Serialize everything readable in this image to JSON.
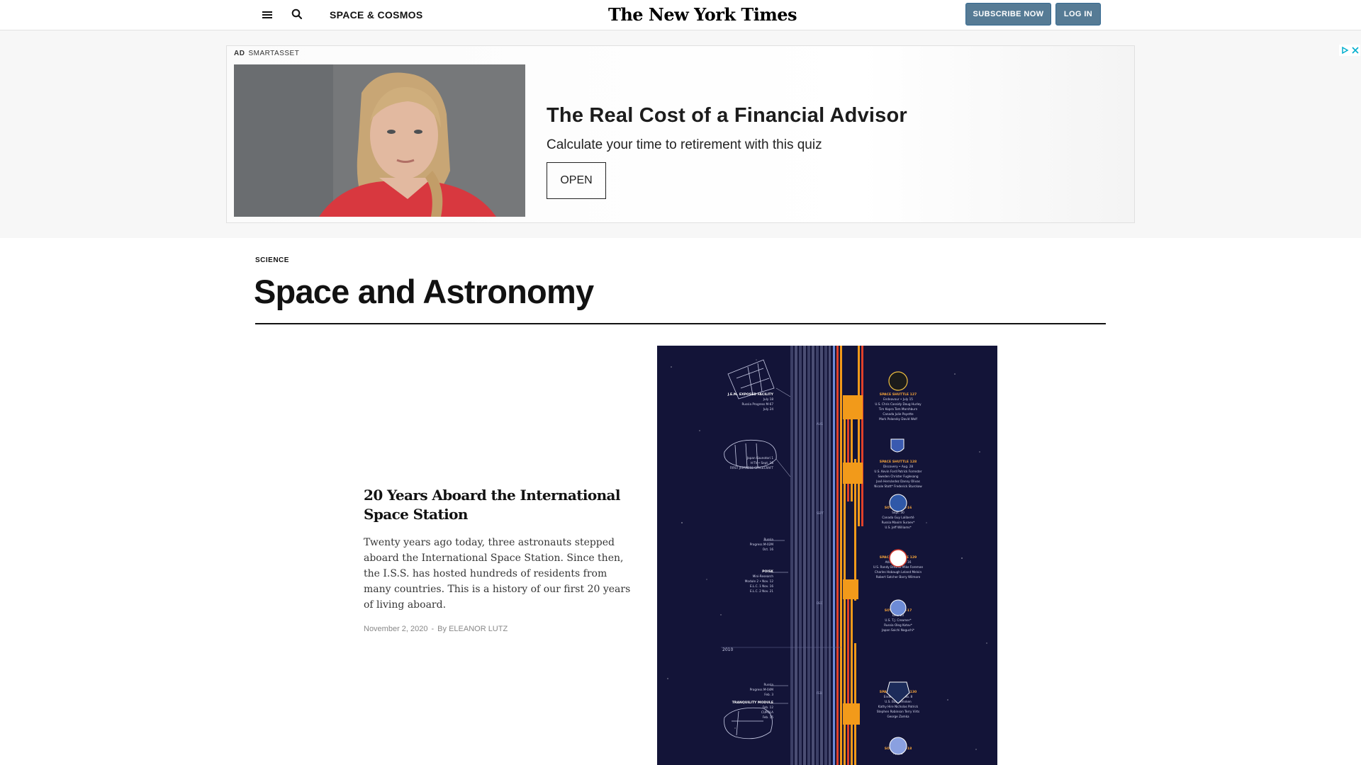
{
  "header": {
    "section_link": "SPACE & COSMOS",
    "logo": "The New York Times",
    "subscribe_label": "SUBSCRIBE NOW",
    "login_label": "LOG IN",
    "icons": [
      "menu-icon",
      "search-icon"
    ]
  },
  "ad": {
    "label": "AD",
    "sponsor": "SMARTASSET",
    "title": "The Real Cost of a Financial Advisor",
    "subtitle": "Calculate your time to retirement with this quiz",
    "cta": "OPEN",
    "icons": [
      "adchoices-icon",
      "close-icon"
    ]
  },
  "section": {
    "kicker": "SCIENCE",
    "title": "Space and Astronomy"
  },
  "story": {
    "headline": "20 Years Aboard the International Space Station",
    "summary": "Twenty years ago today, three astronauts stepped aboard the International Space Station. Since then, the I.S.S. has hosted hundreds of residents from many countries. This is a history of our first 20 years of living aboard.",
    "date": "November 2, 2020",
    "byline": "By ELEANOR LUTZ"
  },
  "graphic": {
    "year_label": "2010",
    "month_labels": [
      "AUG",
      "SEPT",
      "DEC",
      "FEB"
    ],
    "left_labels": [
      {
        "name": "J.E.M. EXPOSED FACILITY",
        "lines": [
          "July 18",
          "Russia  Progress M-67",
          "July 24"
        ]
      },
      {
        "name": "",
        "lines": [
          "Japan  Kounotori 1",
          "H-TV • Sept. 18",
          "FIRST JAPANESE SPACECRAFT"
        ]
      },
      {
        "name": "",
        "lines": [
          "Russia",
          "Progress M-02M",
          "Oct. 16"
        ]
      },
      {
        "name": "POISK",
        "lines": [
          "Mini-Research",
          "Module 2 • Nov. 12",
          "E.L.C. 1  Nov. 16",
          "E.L.C. 2  Nov. 21"
        ]
      },
      {
        "name": "",
        "lines": [
          "Russia",
          "Progress M-04M",
          "Feb. 3"
        ]
      },
      {
        "name": "TRANQUILITY MODULE",
        "lines": [
          "Feb. 12",
          "CUPOLA",
          "Feb. 15"
        ]
      }
    ],
    "right_labels": [
      {
        "name": "SPACE SHUTTLE 127",
        "lines": [
          "Endeavour • July 15",
          "U.S.  Chris Cassidy  Doug Hurley",
          "Tim Kopra  Tom Marshburn",
          "Canada  Julie Payette",
          "Mark Polansky  David Wolf"
        ]
      },
      {
        "name": "SPACE SHUTTLE 128",
        "lines": [
          "Discovery • Aug. 28",
          "U.S.  Kevin Ford  Patrick Forrester",
          "Sweden  Christer Fuglesang",
          "José Hernández  Danny Olivas",
          "Nicole Stott*  Frederick Sturckow"
        ]
      },
      {
        "name": "SOYUZ TMA-16",
        "lines": [
          "Sept. 30",
          "Canada  Guy Laliberté",
          "Russia  Maxim Suraev*",
          "U.S.  Jeff Williams*"
        ]
      },
      {
        "name": "SPACE SHUTTLE 129",
        "lines": [
          "Atlantis • Nov. 16",
          "U.S.  Randy Bresnik  Mike Foreman",
          "Charles Hobaugh  Leland Melvin",
          "Robert Satcher  Barry Wilmore"
        ]
      },
      {
        "name": "SOYUZ TMA-17",
        "lines": [
          "Dec. 20",
          "U.S.  T.J. Creamer*",
          "Russia  Oleg Kotov*",
          "Japan  Soichi Noguchi*"
        ]
      },
      {
        "name": "SPACE SHUTTLE 130",
        "lines": [
          "Endeavour • Feb. 8",
          "U.S.  Bob Behnken",
          "Kathy Hire  Nicholas Patrick",
          "Stephen Robinson  Terry Virts",
          "George Zamka"
        ]
      },
      {
        "name": "SOYUZ TMA-18",
        "lines": [
          "April 2"
        ]
      }
    ],
    "colors": {
      "background": "#131438",
      "orange": "#f29a1a",
      "red": "#e0402a",
      "blue": "#6d8bd6",
      "stripe": "#3c3f66"
    }
  }
}
